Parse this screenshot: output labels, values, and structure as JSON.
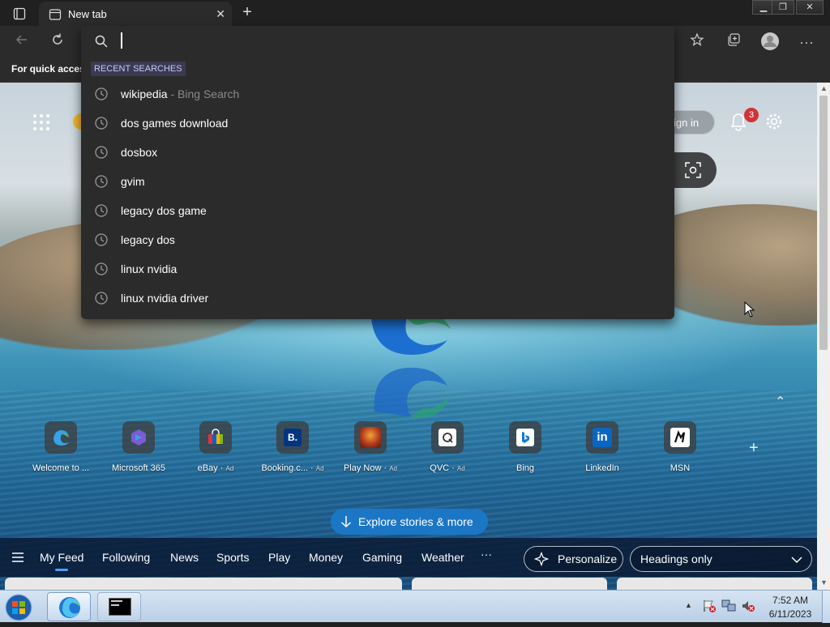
{
  "browser": {
    "tab_title": "New tab",
    "favorites_hint": "For quick access"
  },
  "omnibox": {
    "value": "",
    "recent_label": "RECENT SEARCHES",
    "suggestions": [
      {
        "text": "wikipedia",
        "extra": " - Bing Search"
      },
      {
        "text": "dos games download",
        "extra": ""
      },
      {
        "text": "dosbox",
        "extra": ""
      },
      {
        "text": "gvim",
        "extra": ""
      },
      {
        "text": "legacy dos game",
        "extra": ""
      },
      {
        "text": "legacy dos",
        "extra": ""
      },
      {
        "text": "linux nvidia",
        "extra": ""
      },
      {
        "text": "linux nvidia driver",
        "extra": ""
      }
    ]
  },
  "page": {
    "signin_label": "ign in",
    "notification_count": "3",
    "tiles": [
      {
        "label": "Welcome to ...",
        "ad": ""
      },
      {
        "label": "Microsoft 365",
        "ad": ""
      },
      {
        "label": "eBay",
        "ad": "Ad"
      },
      {
        "label": "Booking.c...",
        "ad": "Ad"
      },
      {
        "label": "Play Now",
        "ad": "Ad"
      },
      {
        "label": "QVC",
        "ad": "Ad"
      },
      {
        "label": "Bing",
        "ad": ""
      },
      {
        "label": "LinkedIn",
        "ad": ""
      },
      {
        "label": "MSN",
        "ad": ""
      }
    ],
    "explore_label": "Explore stories & more",
    "feed_tabs": [
      "My Feed",
      "Following",
      "News",
      "Sports",
      "Play",
      "Money",
      "Gaming",
      "Weather"
    ],
    "more_label": "···",
    "personalize_label": "Personalize",
    "headings_label": "Headings only"
  },
  "taskbar": {
    "time": "7:52 AM",
    "date": "6/11/2023"
  },
  "colors": {
    "accent": "#1b77c6",
    "dropdown_bg": "#2b2b2b",
    "chrome_bg": "#202020"
  }
}
